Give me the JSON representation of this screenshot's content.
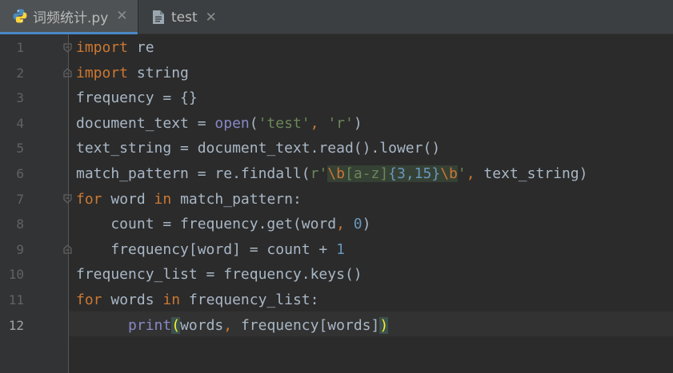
{
  "tabs": [
    {
      "label": "词频统计.py",
      "close": "✕",
      "icon": "python-file-icon"
    },
    {
      "label": "test",
      "close": "✕",
      "icon": "text-file-icon"
    }
  ],
  "editor": {
    "line_numbers": [
      "1",
      "2",
      "3",
      "4",
      "5",
      "6",
      "7",
      "8",
      "9",
      "10",
      "11",
      "12"
    ],
    "current_line": 12,
    "code": {
      "l1_kw": "import",
      "l1_rest": " re",
      "l2_kw": "import",
      "l2_rest": " string",
      "l3": "frequency = {}",
      "l4_a": "document_text = ",
      "l4_fn": "open",
      "l4_b": "(",
      "l4_s1": "'test'",
      "l4_c": ", ",
      "l4_s2": "'r'",
      "l4_d": ")",
      "l5": "text_string = document_text.read().lower()",
      "l6_a": "match_pattern = re.findall(",
      "l6_r": "r'",
      "l6_e1": "\\b",
      "l6_cls": "[a-z]",
      "l6_q": "{3,15}",
      "l6_e2": "\\b",
      "l6_end": "'",
      "l6_c": ", ",
      "l6_b": "text_string)",
      "l7_kw1": "for",
      "l7_a": " word ",
      "l7_kw2": "in",
      "l7_b": " match_pattern:",
      "l8_a": "    count = frequency.get(word",
      "l8_c": ", ",
      "l8_n": "0",
      "l8_b": ")",
      "l9_a": "    frequency[word] = count + ",
      "l9_n": "1",
      "l10": "frequency_list = frequency.keys()",
      "l11_kw1": "for",
      "l11_a": " words ",
      "l11_kw2": "in",
      "l11_b": " frequency_list:",
      "l12_indent": "      ",
      "l12_fn": "print",
      "l12_p1": "(",
      "l12_a": "words",
      "l12_c": ", ",
      "l12_b": "frequency[words]",
      "l12_p2": ")"
    }
  },
  "colors": {
    "background": "#2b2b2b",
    "gutter": "#313335",
    "keyword": "#cc7832",
    "string": "#6a8759",
    "number": "#6897bb",
    "builtin": "#8888c6",
    "identifier": "#a9b7c6",
    "tab_accent": "#4a88c7"
  }
}
